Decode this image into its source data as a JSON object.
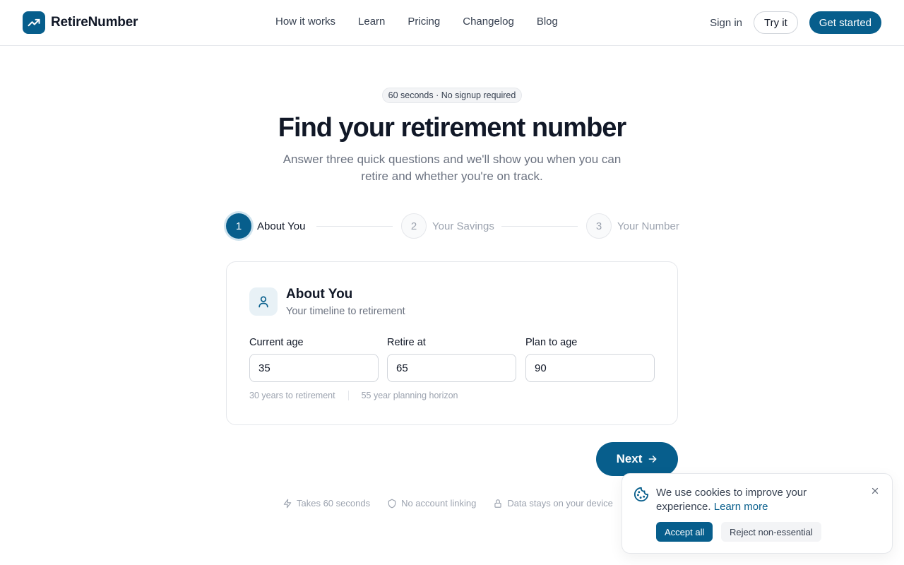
{
  "brand": {
    "name": "RetireNumber",
    "color": "#075e8c"
  },
  "nav": {
    "items": [
      "How it works",
      "Learn",
      "Pricing",
      "Changelog",
      "Blog"
    ],
    "sign_in": "Sign in",
    "try_it": "Try it",
    "get_started": "Get started"
  },
  "hero": {
    "badge": "60 seconds · No signup required",
    "title": "Find your retirement number",
    "subtitle": "Answer three quick questions and we'll show you when you can retire and whether you're on track."
  },
  "stepper": {
    "current": 1,
    "steps": [
      {
        "number": "1",
        "label": "About You"
      },
      {
        "number": "2",
        "label": "Your Savings"
      },
      {
        "number": "3",
        "label": "Your Number"
      }
    ]
  },
  "card": {
    "title": "About You",
    "subtitle": "Your timeline to retirement",
    "fields": [
      {
        "label": "Current age",
        "value": "35"
      },
      {
        "label": "Retire at",
        "value": "65"
      },
      {
        "label": "Plan to age",
        "value": "90"
      }
    ],
    "hints": [
      "30 years to retirement",
      "55 year planning horizon"
    ]
  },
  "next_label": "Next",
  "trust": [
    "Takes 60 seconds",
    "No account linking",
    "Data stays on your device"
  ],
  "cookie": {
    "text": "We use cookies to improve your experience.",
    "link": "Learn more",
    "accept": "Accept all",
    "reject": "Reject non-essential"
  }
}
